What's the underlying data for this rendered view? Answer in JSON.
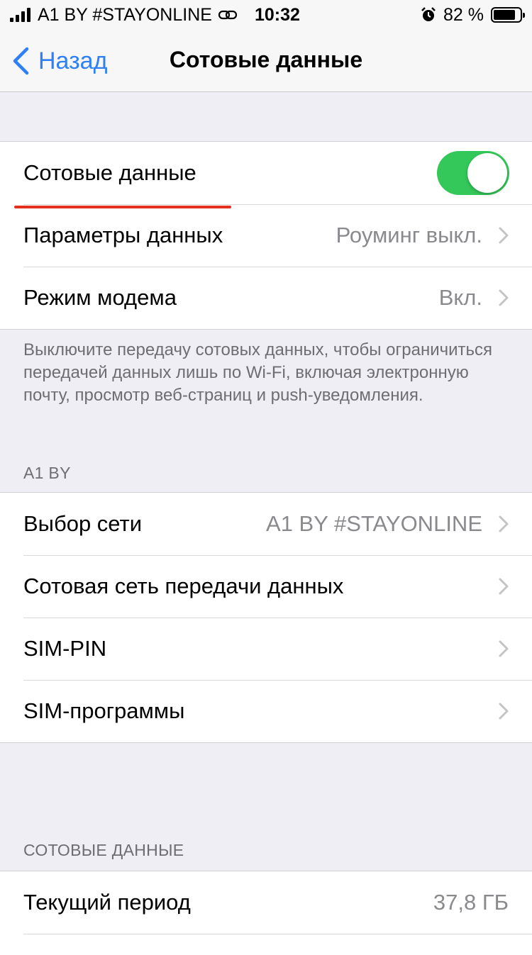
{
  "status": {
    "carrier": "A1 BY #STAYONLINE",
    "time": "10:32",
    "battery": "82 %",
    "battery_level": 0.82
  },
  "nav": {
    "back_label": "Назад",
    "title": "Сотовые данные"
  },
  "group1": {
    "cellular_data_label": "Сотовые данные",
    "cellular_data_on": true,
    "data_options_label": "Параметры данных",
    "data_options_value": "Роуминг выкл.",
    "hotspot_label": "Режим модема",
    "hotspot_value": "Вкл."
  },
  "group1_footer": "Выключите передачу сотовых данных, чтобы ограничиться передачей данных лишь по Wi-Fi, включая электронную почту, просмотр веб-страниц и push-уведомления.",
  "section_a1": {
    "header": "A1 BY",
    "network_selection_label": "Выбор сети",
    "network_selection_value": "A1 BY #STAYONLINE",
    "cellular_network_label": "Сотовая сеть передачи данных",
    "sim_pin_label": "SIM-PIN",
    "sim_apps_label": "SIM-программы"
  },
  "section_usage": {
    "header": "СОТОВЫЕ ДАННЫЕ",
    "current_period_label": "Текущий период",
    "current_period_value": "37,8 ГБ"
  },
  "colors": {
    "accent": "#2f7ff6",
    "toggle_on": "#34c759",
    "highlight_underline": "#e5301f"
  }
}
